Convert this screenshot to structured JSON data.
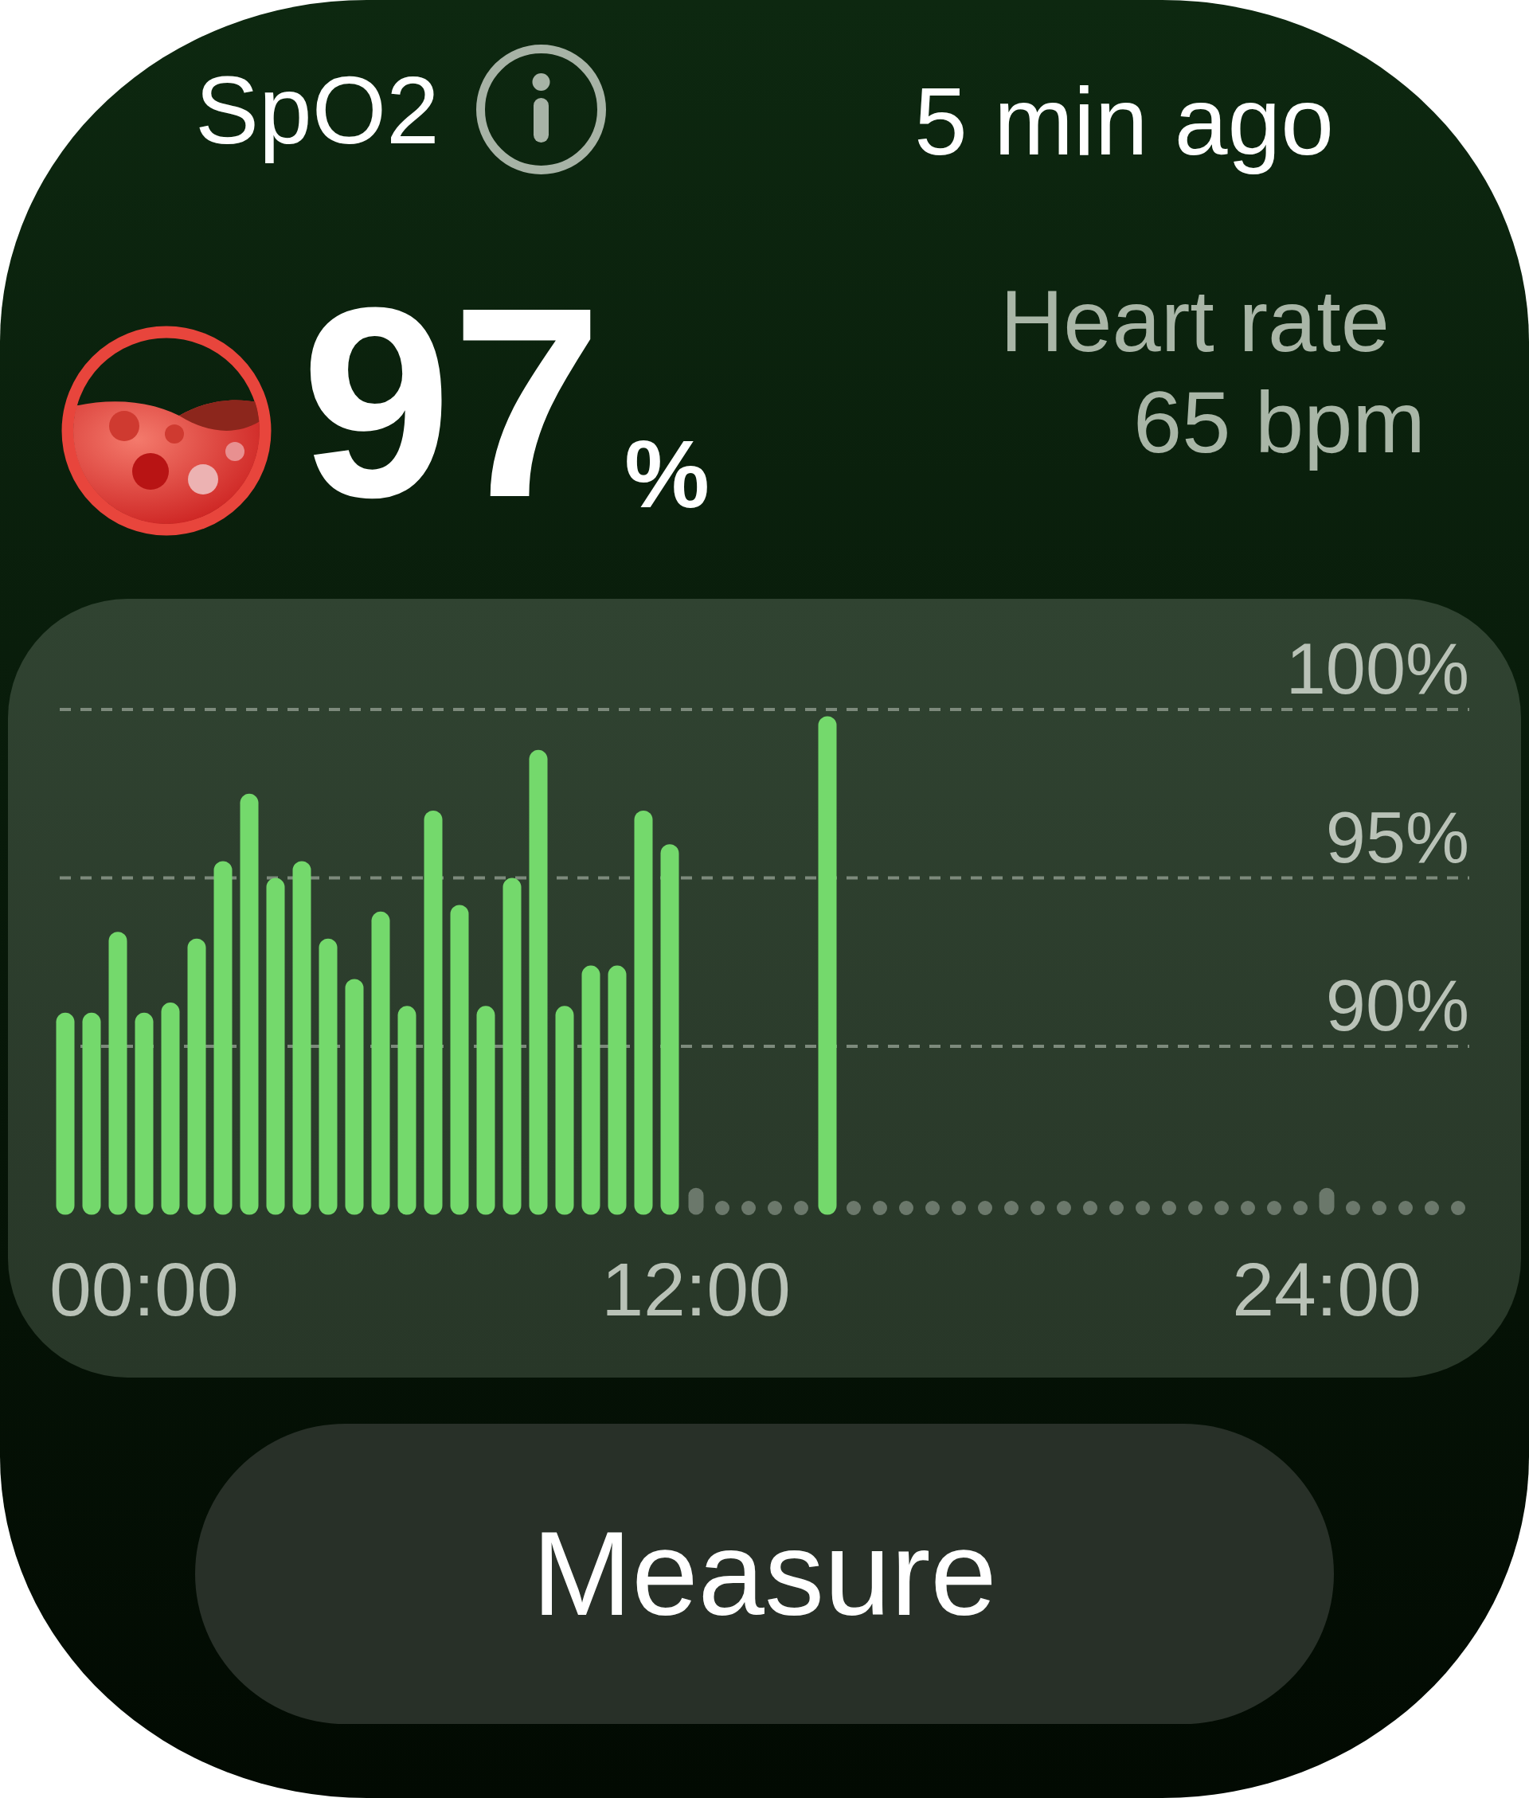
{
  "header": {
    "title": "SpO2",
    "updated": "5 min ago"
  },
  "reading": {
    "value": "97",
    "unit": "%"
  },
  "heart_rate": {
    "label": "Heart rate",
    "value": "65 bpm"
  },
  "chart": {
    "chart_data": {
      "type": "bar",
      "x": [
        0,
        0.5,
        1,
        1.5,
        2,
        2.5,
        3,
        3.5,
        4,
        4.5,
        5,
        5.5,
        6,
        6.5,
        7,
        7.5,
        8,
        8.5,
        9,
        9.5,
        10,
        10.5,
        11,
        11.5,
        12,
        12.5,
        13,
        13.5,
        14,
        14.5,
        15,
        15.5,
        16,
        16.5,
        17,
        17.5,
        18,
        18.5,
        19,
        19.5,
        20,
        20.5,
        21,
        21.5,
        22,
        22.5,
        23,
        23.5,
        24
      ],
      "series": [
        {
          "color": "#74d96c",
          "values": [
            91,
            91,
            93.4,
            91,
            91.3,
            93.2,
            95.5,
            97.5,
            95,
            95.5,
            93.2,
            92,
            94,
            91.2,
            97,
            94.2,
            91.2,
            95,
            98.8,
            91.2,
            92.4,
            92.4,
            97,
            96,
            null,
            null,
            null,
            null,
            null,
            99.8,
            null,
            null,
            null,
            null,
            null,
            null,
            null,
            null,
            null,
            null,
            null,
            null,
            null,
            null,
            null,
            null,
            null,
            null,
            null
          ]
        },
        {
          "color": "#6b786b",
          "values": [
            null,
            null,
            null,
            null,
            null,
            null,
            null,
            null,
            null,
            null,
            null,
            null,
            null,
            null,
            null,
            null,
            null,
            null,
            null,
            null,
            null,
            null,
            null,
            null,
            85.8,
            null,
            null,
            null,
            null,
            null,
            null,
            null,
            null,
            null,
            null,
            null,
            null,
            null,
            null,
            null,
            null,
            null,
            null,
            null,
            null,
            null,
            null,
            null,
            85.8
          ]
        }
      ],
      "xlim": [
        0,
        26.5
      ],
      "ylim": [
        85,
        100
      ],
      "xticks": [
        {
          "value": 0,
          "label": "00:00"
        },
        {
          "value": 12,
          "label": "12:00"
        },
        {
          "value": 24,
          "label": "24:00"
        }
      ],
      "yticks": [
        {
          "value": 90,
          "label": "90%"
        },
        {
          "value": 95,
          "label": "95%"
        },
        {
          "value": 100,
          "label": "100%"
        }
      ]
    }
  },
  "button": {
    "label": "Measure"
  }
}
